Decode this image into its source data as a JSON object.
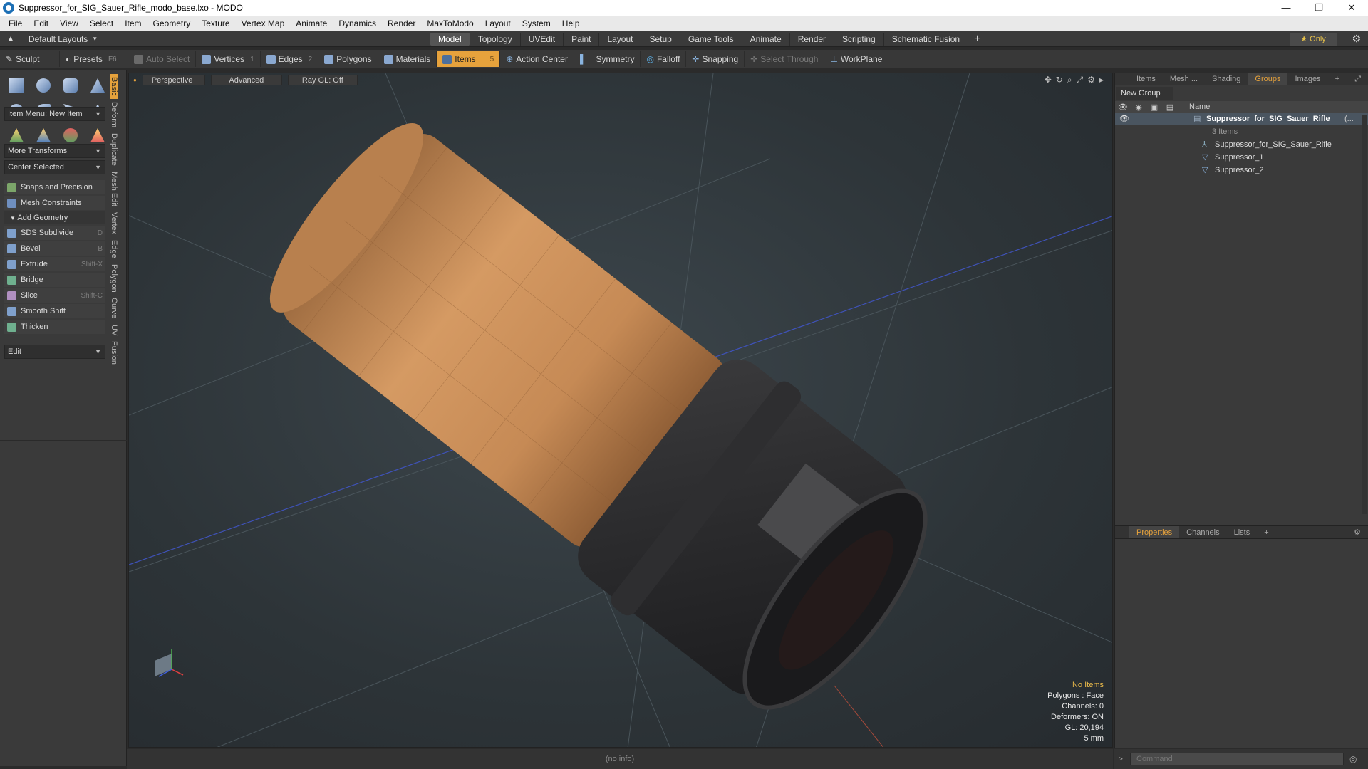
{
  "window": {
    "title": "Suppressor_for_SIG_Sauer_Rifle_modo_base.lxo - MODO",
    "controls": [
      "—",
      "❐",
      "✕"
    ]
  },
  "menu": [
    "File",
    "Edit",
    "View",
    "Select",
    "Item",
    "Geometry",
    "Texture",
    "Vertex Map",
    "Animate",
    "Dynamics",
    "Render",
    "MaxToModo",
    "Layout",
    "System",
    "Help"
  ],
  "layoutbar": {
    "layout_label": "Default Layouts",
    "tabs": [
      "Model",
      "Topology",
      "UVEdit",
      "Paint",
      "Layout",
      "Setup",
      "Game Tools",
      "Animate",
      "Render",
      "Scripting",
      "Schematic Fusion"
    ],
    "active_tab": "Model",
    "plus": "+",
    "only_label": "Only"
  },
  "toolrow": {
    "sculpt": "Sculpt",
    "presets": "Presets",
    "presets_sc": "F6",
    "auto_select": "Auto Select",
    "vertices": "Vertices",
    "vertices_sc": "1",
    "edges": "Edges",
    "edges_sc": "2",
    "polygons": "Polygons",
    "materials": "Materials",
    "items": "Items",
    "items_sc": "5",
    "action_center": "Action Center",
    "symmetry": "Symmetry",
    "falloff": "Falloff",
    "snapping": "Snapping",
    "select_through": "Select Through",
    "workplane": "WorkPlane"
  },
  "toolbox": {
    "item_menu": "Item Menu: New Item",
    "more_transforms": "More Transforms",
    "center_selected": "Center Selected",
    "snaps": "Snaps and Precision",
    "mesh_constraints": "Mesh Constraints",
    "add_geometry": "Add Geometry",
    "tools": [
      {
        "label": "SDS Subdivide",
        "sc": "D"
      },
      {
        "label": "Bevel",
        "sc": "B"
      },
      {
        "label": "Extrude",
        "sc": "Shift-X"
      },
      {
        "label": "Bridge",
        "sc": ""
      },
      {
        "label": "Slice",
        "sc": "Shift-C"
      },
      {
        "label": "Smooth Shift",
        "sc": ""
      },
      {
        "label": "Thicken",
        "sc": ""
      }
    ],
    "edit": "Edit",
    "vtabs": [
      "Basic",
      "Deform",
      "Duplicate",
      "Mesh Edit",
      "Vertex",
      "Edge",
      "Polygon",
      "Curve",
      "UV",
      "Fusion"
    ]
  },
  "viewport": {
    "perspective": "Perspective",
    "advanced": "Advanced",
    "raygl": "Ray GL: Off",
    "info": {
      "no_items": "No Items",
      "polygons": "Polygons : Face",
      "channels": "Channels: 0",
      "deformers": "Deformers: ON",
      "gl": "GL: 20,194",
      "scale": "5 mm"
    }
  },
  "rpanel": {
    "tabs": [
      "Items",
      "Mesh ...",
      "Shading",
      "Groups",
      "Images"
    ],
    "active_tab": "Groups",
    "new_group": "New Group",
    "name_header": "Name",
    "group_name": "Suppressor_for_SIG_Sauer_Rifle",
    "group_suffix": "(...",
    "group_count": "3 Items",
    "children": [
      "Suppressor_for_SIG_Sauer_Rifle",
      "Suppressor_1",
      "Suppressor_2"
    ]
  },
  "ppanel": {
    "tabs": [
      "Properties",
      "Channels",
      "Lists"
    ],
    "active_tab": "Properties"
  },
  "status": {
    "info": "(no info)",
    "command_placeholder": "Command"
  },
  "colors": {
    "accent": "#e6a23c",
    "suppressor_tan": "#c68a55",
    "suppressor_dark": "#2a2a2c"
  }
}
